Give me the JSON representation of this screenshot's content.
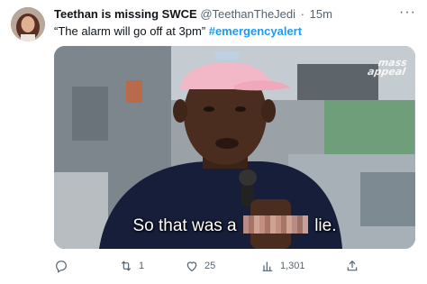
{
  "tweet": {
    "author": {
      "display_name": "Teethan is missing SWCE",
      "handle": "@TeethanTheJedi",
      "separator": "·",
      "timestamp": "15m"
    },
    "text": {
      "main": "“The alarm will go off at 3pm” ",
      "hashtag": "#emergencyalert"
    },
    "media": {
      "watermark_line1": "mass",
      "watermark_line2": "appeal",
      "caption_before": "So that was a",
      "caption_after": "lie."
    },
    "actions": {
      "reply_count": "",
      "retweet_count": "1",
      "like_count": "25",
      "views_count": "1,301"
    }
  },
  "icons": [
    "avatar",
    "more-icon",
    "reply-icon",
    "retweet-icon",
    "like-icon",
    "views-icon",
    "share-icon"
  ],
  "colors": {
    "text": "#0f1419",
    "secondary": "#536471",
    "accent": "#1d9bf0"
  }
}
